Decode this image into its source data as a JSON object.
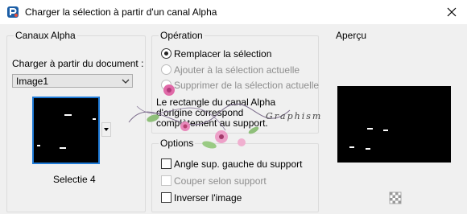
{
  "window": {
    "title": "Charger la sélection à partir d'un canal Alpha",
    "app_icon": "paintshop-pro-icon",
    "close_icon": "close-icon"
  },
  "canaux": {
    "group_label": "Canaux Alpha",
    "load_from_label": "Charger à partir du document :",
    "document_value": "Image1",
    "channel_name": "Selectie 4"
  },
  "operation": {
    "group_label": "Opération",
    "options": [
      {
        "label": "Remplacer la sélection",
        "selected": true,
        "enabled": true
      },
      {
        "label": "Ajouter à la sélection actuelle",
        "selected": false,
        "enabled": false
      },
      {
        "label": "Supprimer de la sélection actuelle",
        "selected": false,
        "enabled": false
      }
    ],
    "info_lines": [
      "Le rectangle du canal Alpha",
      "d'origine correspond",
      "complètement au support."
    ]
  },
  "options": {
    "group_label": "Options",
    "checkboxes": [
      {
        "label": "Angle sup. gauche du support",
        "checked": false,
        "enabled": true
      },
      {
        "label": "Couper selon support",
        "checked": false,
        "enabled": false
      },
      {
        "label": "Inverser l'image",
        "checked": false,
        "enabled": true
      }
    ]
  },
  "apercu": {
    "group_label": "Aperçu",
    "toggle_icon": "transparency-grid-icon"
  },
  "watermark": {
    "text": "Graphisme"
  },
  "colors": {
    "accent": "#1e7ad7",
    "dialog_bg": "#f0f0f0",
    "preview_bg": "#000000"
  }
}
